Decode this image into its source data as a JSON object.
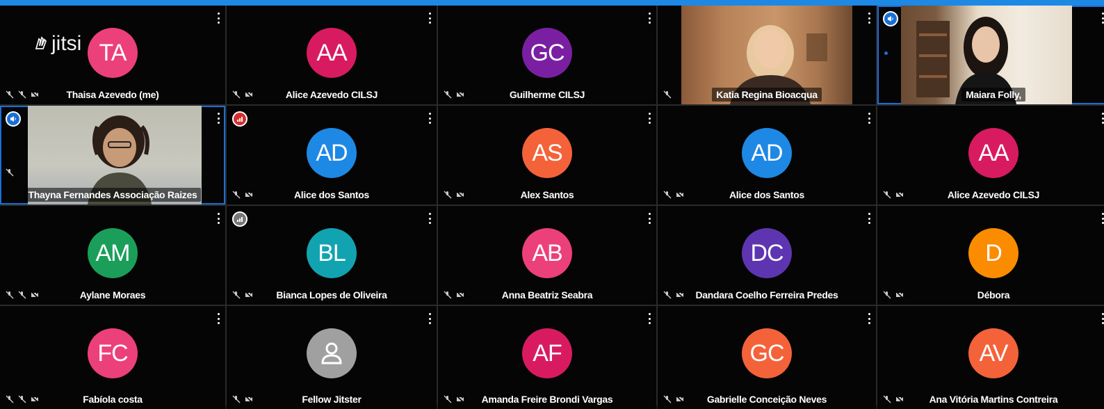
{
  "app": {
    "logo_text": "jitsi"
  },
  "colors": {
    "accent": "#1e88e5",
    "speaking_border": "#1a6fd6",
    "bad_connection": "#d32f2f",
    "neutral_connection": "#777777"
  },
  "tiles": [
    {
      "name": "Thaisa Azevedo (me)",
      "initials": "TA",
      "color": "#ec407a"
    },
    {
      "name": "Alice Azevedo CILSJ",
      "initials": "AA",
      "color": "#d81b60"
    },
    {
      "name": "Guilherme CILSJ",
      "initials": "GC",
      "color": "#7b1fa2"
    },
    {
      "name": "Katia Regina Bioacqua",
      "initials": "",
      "color": ""
    },
    {
      "name": "Maiara Folly,",
      "initials": "",
      "color": ""
    },
    {
      "name": "Thayna Fernandes Associação Raizes",
      "initials": "",
      "color": ""
    },
    {
      "name": "Alice dos Santos",
      "initials": "AD",
      "color": "#1e88e5"
    },
    {
      "name": "Alex Santos",
      "initials": "AS",
      "color": "#f4623a"
    },
    {
      "name": "Alice dos Santos",
      "initials": "AD",
      "color": "#1e88e5"
    },
    {
      "name": "Alice Azevedo CILSJ",
      "initials": "AA",
      "color": "#d81b60"
    },
    {
      "name": "Aylane Moraes",
      "initials": "AM",
      "color": "#1b9e5a"
    },
    {
      "name": "Bianca Lopes de Oliveira",
      "initials": "BL",
      "color": "#12a3b0"
    },
    {
      "name": "Anna Beatriz Seabra",
      "initials": "AB",
      "color": "#ec407a"
    },
    {
      "name": "Dandara Coelho Ferreira Predes",
      "initials": "DC",
      "color": "#5e35b1"
    },
    {
      "name": "Débora",
      "initials": "D",
      "color": "#fb8c00"
    },
    {
      "name": "Fabíola costa",
      "initials": "FC",
      "color": "#ec407a"
    },
    {
      "name": "Fellow Jitster",
      "initials": "",
      "color": "#a0a0a0"
    },
    {
      "name": "Amanda Freire Brondi Vargas",
      "initials": "AF",
      "color": "#d81b60"
    },
    {
      "name": "Gabrielle Conceição Neves",
      "initials": "GC",
      "color": "#f4623a"
    },
    {
      "name": "Ana Vitória Martins Contreira",
      "initials": "AV",
      "color": "#f4623a"
    }
  ]
}
